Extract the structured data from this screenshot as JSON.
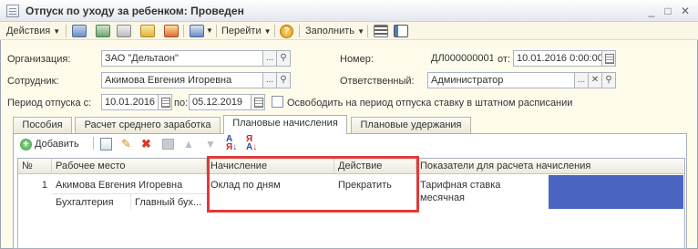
{
  "window": {
    "title": "Отпуск по уходу за ребенком: Проведен"
  },
  "toolbar": {
    "actions_label": "Действия",
    "goto_label": "Перейти",
    "fill_label": "Заполнить",
    "help_label": "?"
  },
  "form": {
    "org_label": "Организация:",
    "org_value": "ЗАО \"Дельтаон\"",
    "number_label": "Номер:",
    "number_value": "ДЛ000000001",
    "from_label": "от:",
    "date_value": "10.01.2016 0:00:00",
    "employee_label": "Сотрудник:",
    "employee_value": "Акимова Евгения Игоревна",
    "responsible_label": "Ответственный:",
    "responsible_value": "Администратор",
    "period_label": "Период отпуска с:",
    "period_from": "10.01.2016",
    "period_to_label": "по:",
    "period_to": "05.12.2019",
    "release_label": "Освободить на период отпуска ставку в штатном расписании"
  },
  "tabs": [
    {
      "label": "Пособия"
    },
    {
      "label": "Расчет среднего заработка"
    },
    {
      "label": "Плановые начисления"
    },
    {
      "label": "Плановые удержания"
    }
  ],
  "subtoolbar": {
    "add_label": "Добавить"
  },
  "table": {
    "headers": [
      "№",
      "Рабочее место",
      "Начисление",
      "Действие",
      "Показатели для расчета начисления"
    ],
    "rows": [
      {
        "num": "1",
        "employee": "Акимова Евгения Игоревна",
        "department": "Бухгалтерия",
        "position": "Главный бух...",
        "accrual": "Оклад по дням",
        "action": "Прекратить",
        "indicator_line1": "Тарифная ставка",
        "indicator_line2": "месячная"
      }
    ]
  },
  "colors": {
    "highlight_border": "#e03a3a",
    "selected_cell": "#4a64c2"
  }
}
